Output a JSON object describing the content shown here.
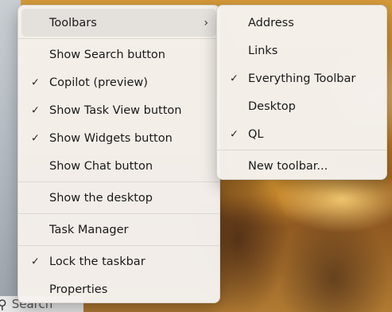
{
  "context_menu": {
    "items": [
      {
        "label": "Toolbars",
        "checked": false,
        "submenu": true
      },
      {
        "label": "Show Search button",
        "checked": false
      },
      {
        "label": "Copilot (preview)",
        "checked": true
      },
      {
        "label": "Show Task View button",
        "checked": true
      },
      {
        "label": "Show Widgets button",
        "checked": true
      },
      {
        "label": "Show Chat button",
        "checked": false
      },
      {
        "label": "Show the desktop",
        "checked": false
      },
      {
        "label": "Task Manager",
        "checked": false
      },
      {
        "label": "Lock the taskbar",
        "checked": true
      },
      {
        "label": "Properties",
        "checked": false
      }
    ]
  },
  "toolbars_submenu": {
    "items": [
      {
        "label": "Address",
        "checked": false
      },
      {
        "label": "Links",
        "checked": false
      },
      {
        "label": "Everything Toolbar",
        "checked": true
      },
      {
        "label": "Desktop",
        "checked": false
      },
      {
        "label": "QL",
        "checked": true
      },
      {
        "label": "New toolbar...",
        "checked": false
      }
    ]
  },
  "taskbar": {
    "search_label": "Search"
  },
  "icons": {
    "check": "✓",
    "chevron_right": "›",
    "search": "⚲"
  }
}
